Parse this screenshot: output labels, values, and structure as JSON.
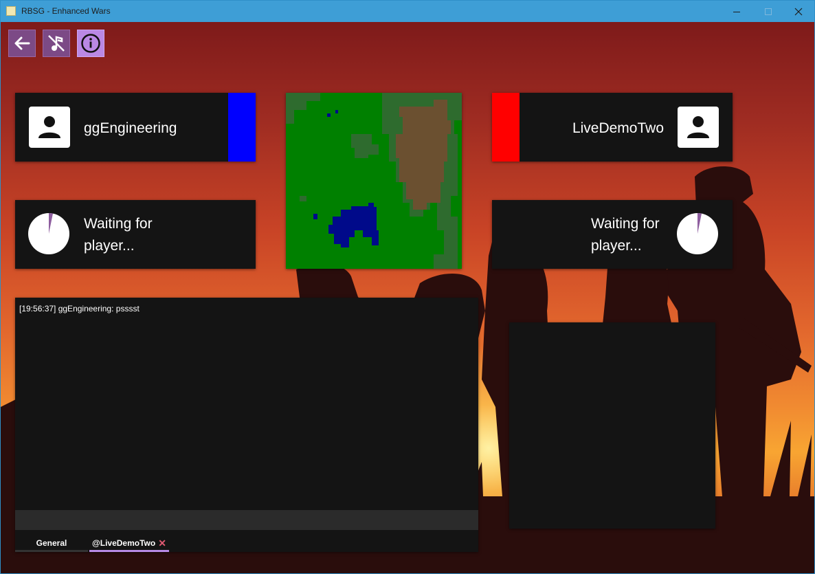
{
  "window": {
    "title": "RBSG - Enhanced Wars"
  },
  "toolbar": {
    "back": "back-arrow",
    "music": "music-off",
    "info": "info"
  },
  "player_left": {
    "name": "ggEngineering",
    "color": "#0000ff"
  },
  "player_right": {
    "name": "LiveDemoTwo",
    "color": "#ff0000"
  },
  "waiting_left": {
    "line1": "Waiting for",
    "line2": "player..."
  },
  "waiting_right": {
    "line1": "Waiting for",
    "line2": "player..."
  },
  "chat": {
    "messages": [
      "[19:56:37] ggEngineering: psssst"
    ],
    "input_value": "",
    "tabs": [
      {
        "label": "General",
        "active": false
      },
      {
        "label": "@LiveDemoTwo",
        "active": true,
        "closable": true,
        "close_glyph": "✕"
      }
    ]
  },
  "colors": {
    "accent": "#b88ae6",
    "panel": "#141414",
    "map_grass": "#008000",
    "map_forest": "#2e6b2e",
    "map_mountain": "#6b5030",
    "map_water": "#000a8a"
  }
}
